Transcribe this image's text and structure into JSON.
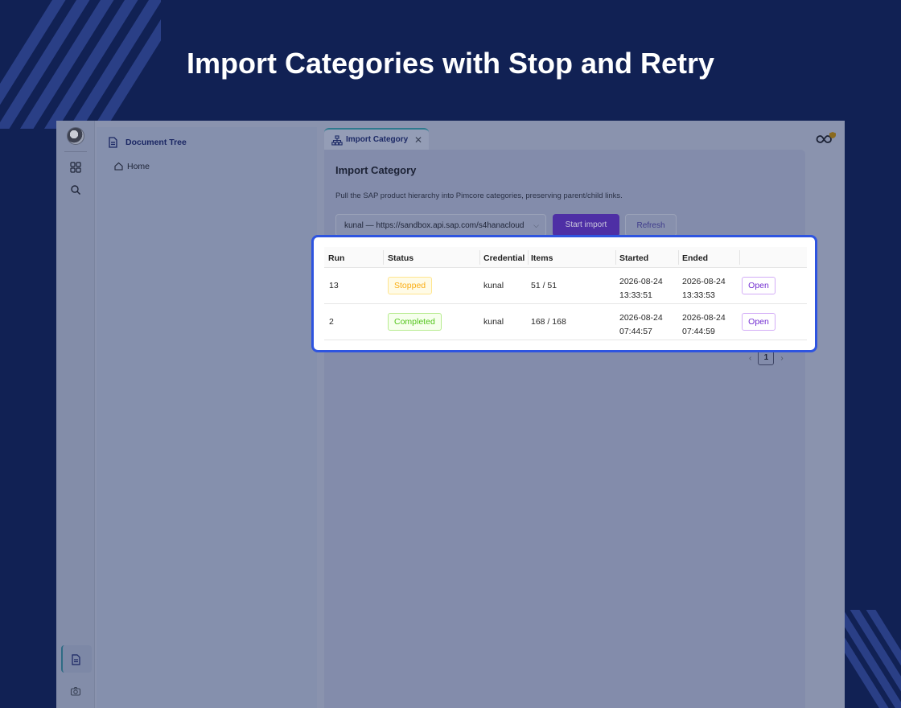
{
  "headline": "Import Categories with Stop and Retry",
  "sidebar": {
    "icons": [
      "avatar",
      "grid-icon",
      "search-icon",
      "document-icon",
      "camera-icon"
    ]
  },
  "tree": {
    "title": "Document Tree",
    "home": "Home"
  },
  "tab": {
    "label": "Import Category",
    "close": "✕"
  },
  "panel": {
    "title": "Import Category",
    "description": "Pull the SAP product hierarchy into Pimcore categories, preserving parent/child links.",
    "credential_select": "kunal — https://sandbox.api.sap.com/s4hanacloud",
    "start_label": "Start import",
    "refresh_label": "Refresh"
  },
  "table": {
    "columns": [
      "Run",
      "Status",
      "Credential",
      "Items",
      "Started",
      "Ended",
      ""
    ],
    "rows": [
      {
        "run": "13",
        "status": "Stopped",
        "credential": "kunal",
        "items": "51 / 51",
        "started_date": "2026-08-24",
        "started_time": "13:33:51",
        "ended_date": "2026-08-24",
        "ended_time": "13:33:53",
        "action": "Open"
      },
      {
        "run": "2",
        "status": "Completed",
        "credential": "kunal",
        "items": "168 / 168",
        "started_date": "2026-08-24",
        "started_time": "07:44:57",
        "ended_date": "2026-08-24",
        "ended_time": "07:44:59",
        "action": "Open"
      }
    ]
  },
  "pagination": {
    "prev": "‹",
    "page": "1",
    "next": "›"
  },
  "colors": {
    "background": "#112154",
    "highlight_border": "#2e54e0",
    "primary_button": "#4e2fa5",
    "stopped": "#faad14",
    "completed": "#52c41a",
    "open_link": "#722ed1"
  }
}
